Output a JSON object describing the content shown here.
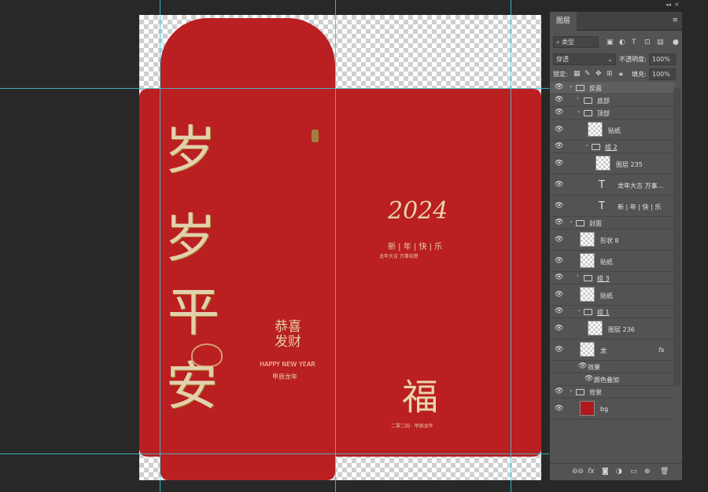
{
  "document": {
    "left_panel": {
      "big_chars": [
        "岁",
        "岁",
        "平",
        "安"
      ],
      "blessing": "恭喜发财",
      "english": "HAPPY NEW YEAR",
      "year_label": "甲辰龙年"
    },
    "right_panel": {
      "year_script": "2024",
      "greeting": "新 | 年 | 快 | 乐",
      "sub_greeting": "龙年大吉  万事如意",
      "fu": "福",
      "bottom_line": "二零二四 · 甲辰龙年"
    }
  },
  "layers_panel": {
    "tab": "图层",
    "kind_filter": "类型",
    "blend_mode": "穿透",
    "opacity_label": "不透明度:",
    "opacity_value": "100%",
    "lock_label": "锁定:",
    "fill_label": "填充:",
    "fill_value": "100%",
    "layers": [
      {
        "name": "反面",
        "type": "group",
        "indent": 0,
        "expanded": true,
        "selected": true
      },
      {
        "name": "底部",
        "type": "group",
        "indent": 1,
        "expanded": false
      },
      {
        "name": "顶部",
        "type": "group",
        "indent": 1,
        "expanded": true
      },
      {
        "name": "贴纸",
        "type": "smart",
        "indent": 2
      },
      {
        "name": "组 2",
        "type": "group",
        "indent": 2,
        "expanded": true
      },
      {
        "name": "图层 235",
        "type": "pixel",
        "indent": 3
      },
      {
        "name": "龙年大吉 万事...",
        "type": "text",
        "indent": 3
      },
      {
        "name": "新 | 年 | 快 | 乐",
        "type": "text",
        "indent": 3
      },
      {
        "name": "封面",
        "type": "group",
        "indent": 0,
        "expanded": true
      },
      {
        "name": "形状 8",
        "type": "smart",
        "indent": 1
      },
      {
        "name": "贴纸",
        "type": "smart",
        "indent": 1
      },
      {
        "name": "组 3",
        "type": "group",
        "indent": 1,
        "expanded": false
      },
      {
        "name": "贴纸",
        "type": "smart",
        "indent": 1
      },
      {
        "name": "组 1",
        "type": "group",
        "indent": 1,
        "expanded": true
      },
      {
        "name": "图层 236",
        "type": "pixel",
        "indent": 2
      },
      {
        "name": "龙",
        "type": "smart",
        "indent": 1,
        "fx": "fx"
      },
      {
        "name": "效果",
        "type": "effects",
        "indent": 2
      },
      {
        "name": "颜色叠加",
        "type": "effect",
        "indent": 3
      },
      {
        "name": "背景",
        "type": "group",
        "indent": 0,
        "expanded": true
      },
      {
        "name": "bg",
        "type": "red",
        "indent": 1
      }
    ],
    "bottom_icons": [
      "link-icon",
      "fx-icon",
      "mask-icon",
      "adjustment-icon",
      "new-group-icon",
      "new-layer-icon",
      "trash-icon"
    ]
  },
  "colors": {
    "envelope_red": "#ba1f21",
    "gold": "#e6d0a6",
    "guide": "#3fc6d8"
  }
}
